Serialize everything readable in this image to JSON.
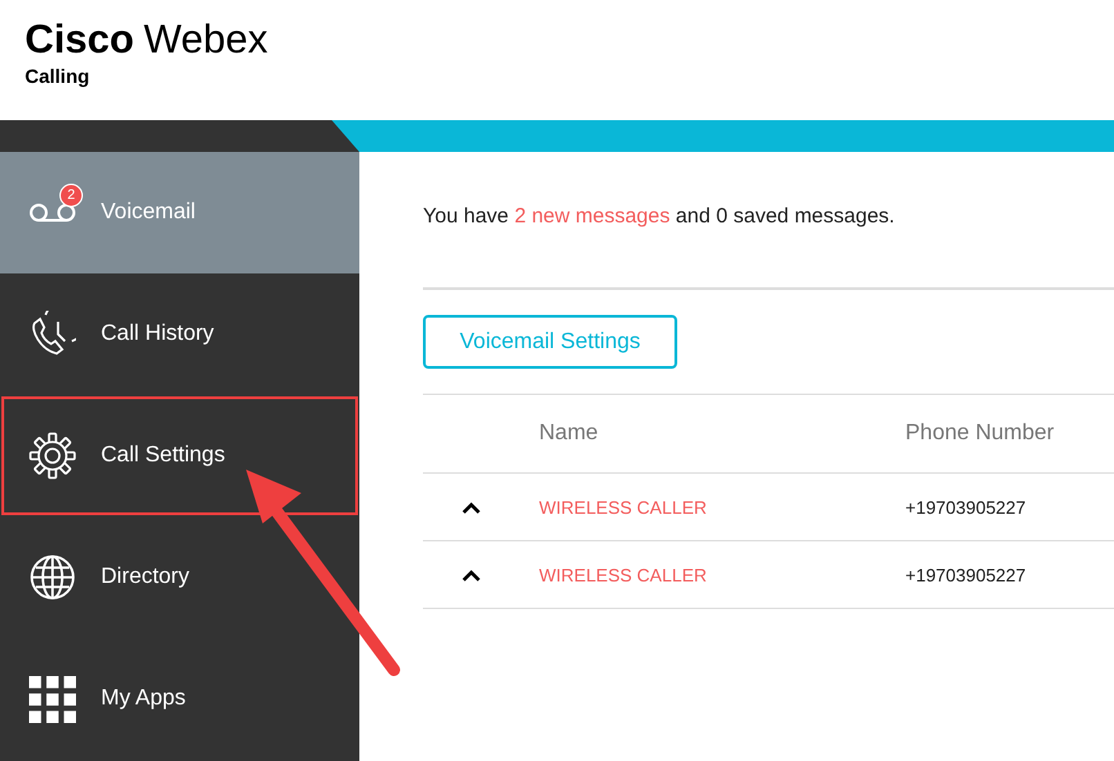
{
  "header": {
    "brand": "Cisco",
    "product": "Webex",
    "subtitle": "Calling"
  },
  "sidebar": {
    "items": [
      {
        "kind": "voicemail",
        "label": "Voicemail",
        "badge": "2",
        "selected": true,
        "highlighted": false
      },
      {
        "kind": "history",
        "label": "Call History",
        "selected": false,
        "highlighted": false
      },
      {
        "kind": "settings",
        "label": "Call Settings",
        "selected": false,
        "highlighted": true
      },
      {
        "kind": "directory",
        "label": "Directory",
        "selected": false,
        "highlighted": false
      },
      {
        "kind": "apps",
        "label": "My Apps",
        "selected": false,
        "highlighted": false
      }
    ]
  },
  "message": {
    "before": "You have ",
    "highlight": "2 new messages",
    "after": " and 0 saved messages."
  },
  "settings_button": "Voicemail Settings",
  "table": {
    "columns": [
      "Name",
      "Phone Number"
    ],
    "rows": [
      {
        "name": "WIRELESS CALLER",
        "phone": "+19703905227"
      },
      {
        "name": "WIRELESS CALLER",
        "phone": "+19703905227"
      }
    ]
  }
}
